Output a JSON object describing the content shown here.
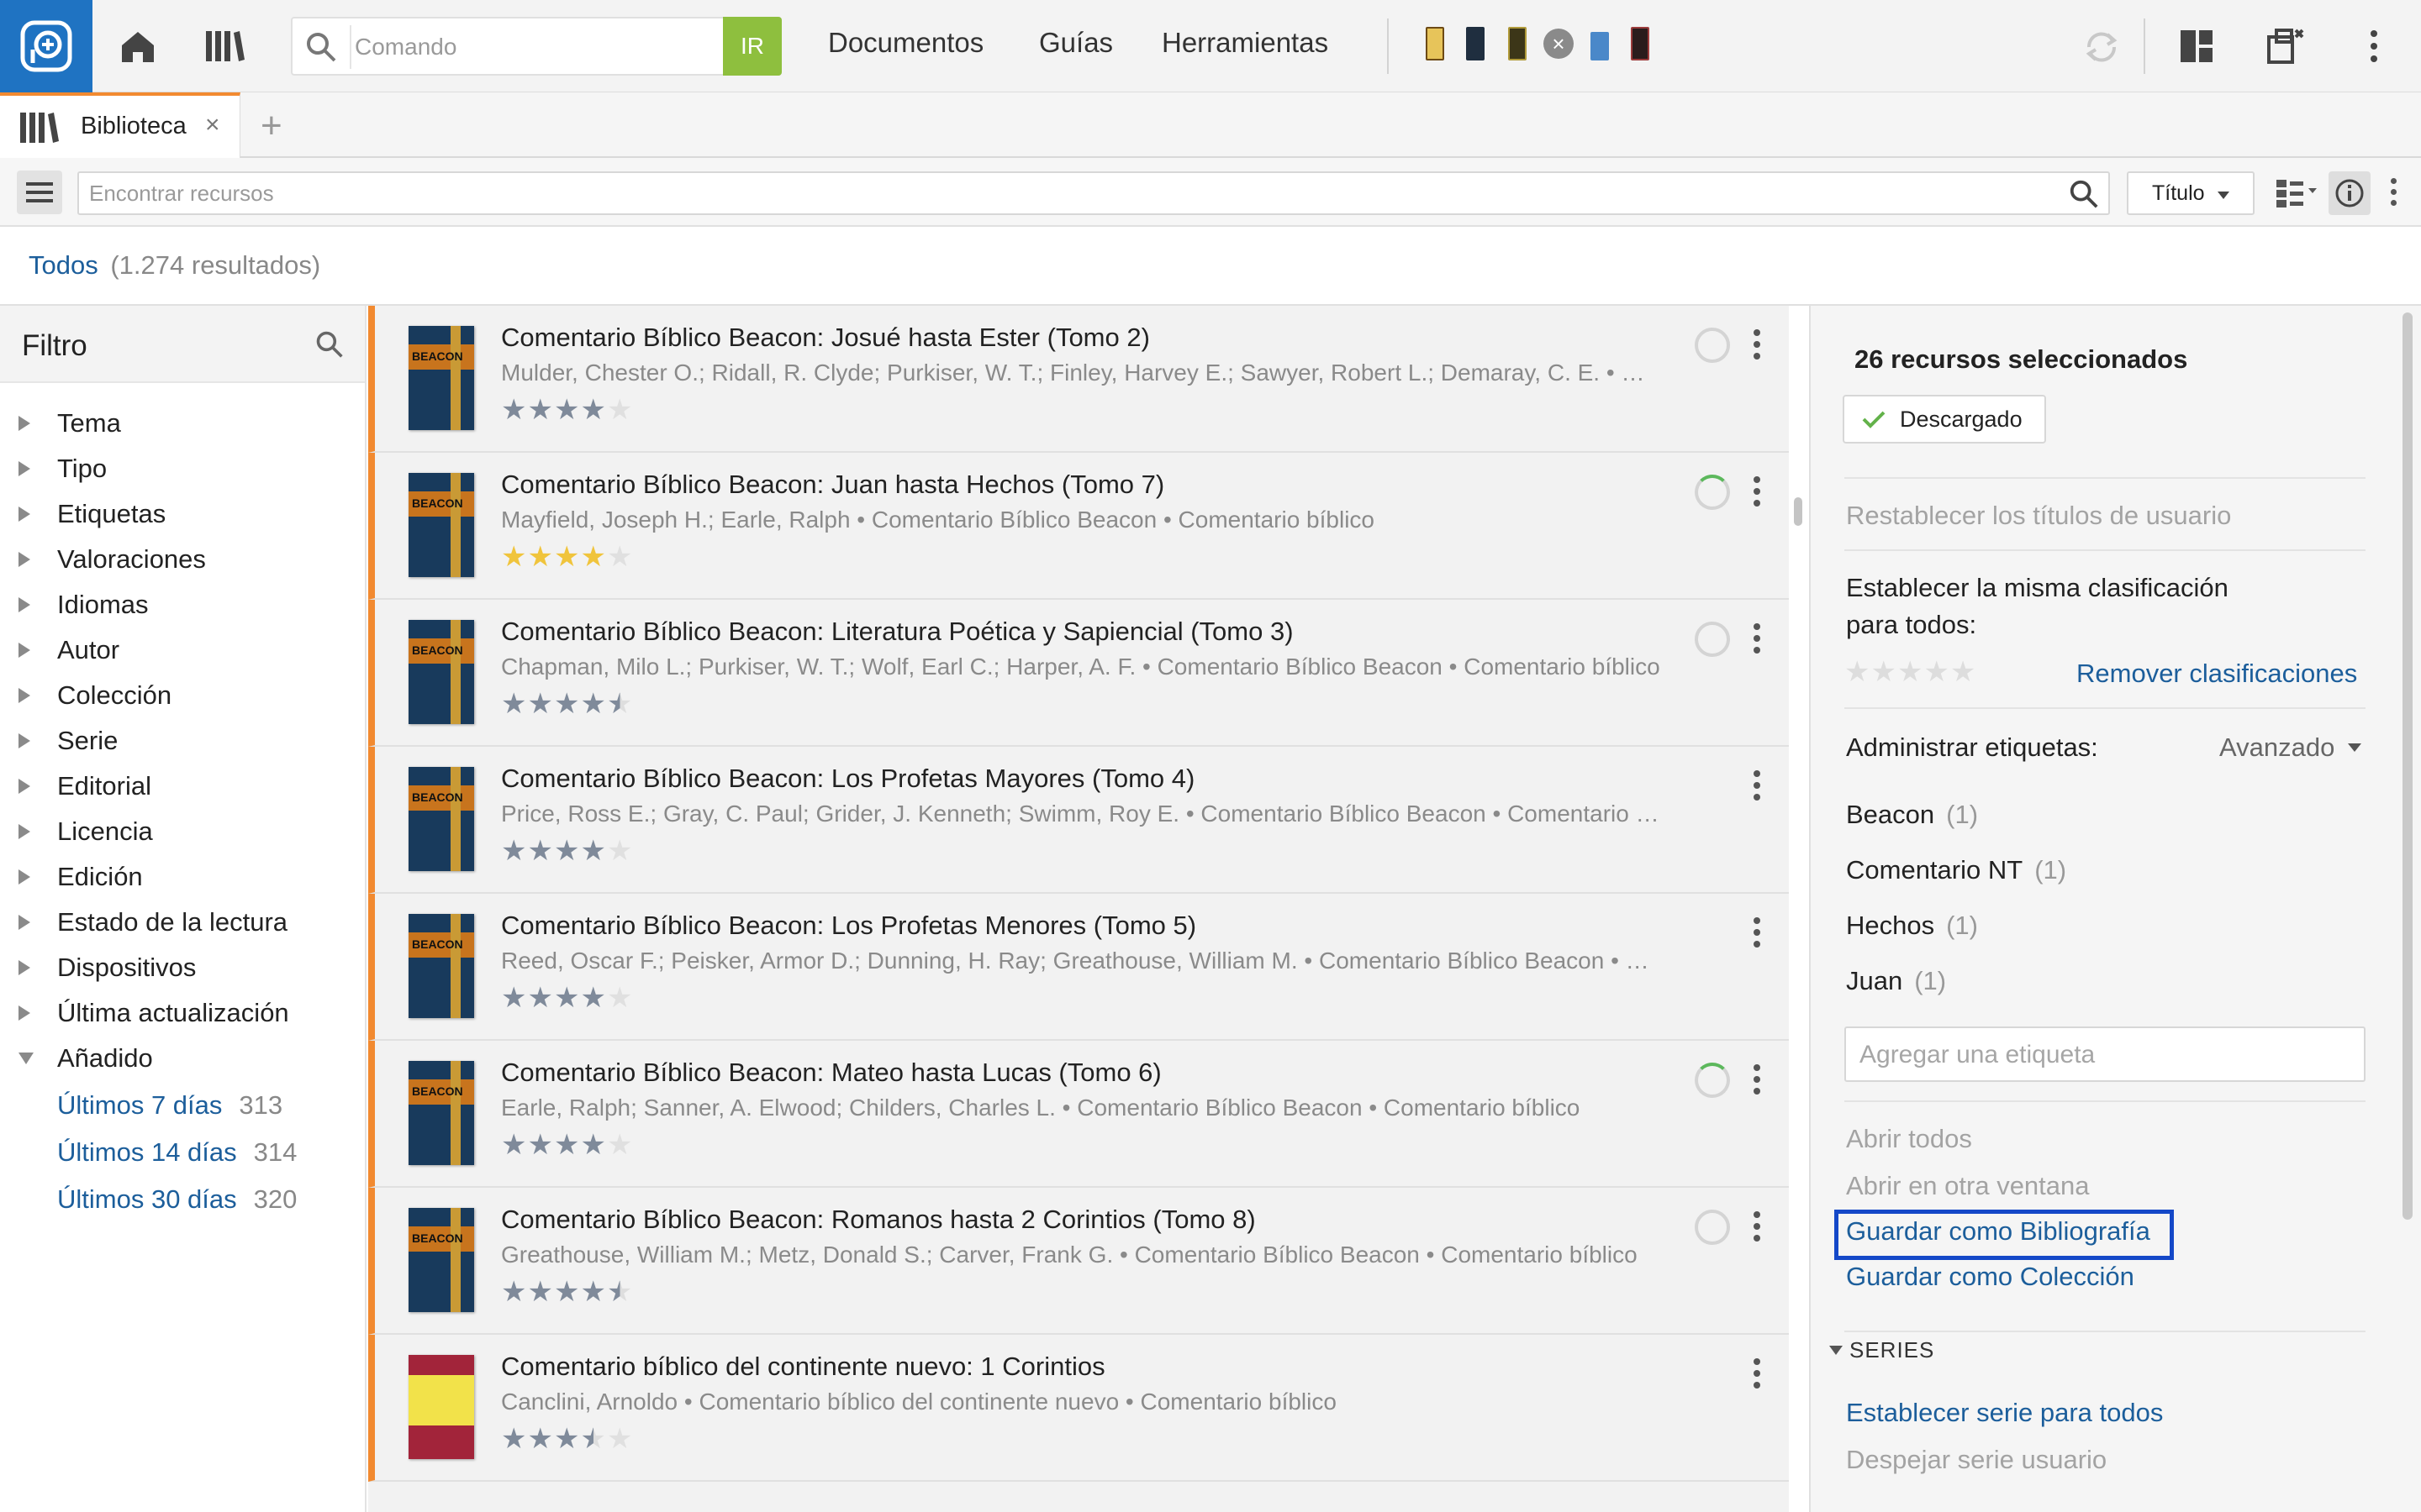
{
  "topbar": {
    "command_placeholder": "Comando",
    "go_label": "IR",
    "nav": [
      "Documentos",
      "Guías",
      "Herramientas"
    ]
  },
  "tab": {
    "label": "Biblioteca",
    "close": "×",
    "add": "+"
  },
  "search": {
    "placeholder": "Encontrar recursos",
    "sort_label": "Título"
  },
  "results": {
    "scope": "Todos",
    "count": "(1.274 resultados)"
  },
  "filter": {
    "title": "Filtro",
    "items": [
      "Tema",
      "Tipo",
      "Etiquetas",
      "Valoraciones",
      "Idiomas",
      "Autor",
      "Colección",
      "Serie",
      "Editorial",
      "Licencia",
      "Edición",
      "Estado de la lectura",
      "Dispositivos",
      "Última actualización"
    ],
    "expanded": {
      "label": "Añadido",
      "subitems": [
        {
          "label": "Últimos 7 días",
          "count": "313"
        },
        {
          "label": "Últimos 14 días",
          "count": "314"
        },
        {
          "label": "Últimos 30 días",
          "count": "320"
        }
      ]
    }
  },
  "resources": [
    {
      "title": "Comentario Bíblico Beacon: Josué hasta Ester (Tomo 2)",
      "meta": "Mulder, Chester O.; Ridall, R. Clyde; Purkiser, W. T.; Finley, Harvey E.; Sawyer, Robert L.; Demaray, C. E. • Comentario Bíblico Beacon • Comentario bíblico",
      "rating": 4,
      "star_color": "#7f8a9a",
      "cover": "BEACON",
      "cover_style": "blue",
      "status": "circle"
    },
    {
      "title": "Comentario Bíblico Beacon: Juan hasta Hechos (Tomo 7)",
      "meta": "Mayfield, Joseph H.; Earle, Ralph • Comentario Bíblico Beacon • Comentario bíblico",
      "rating": 4,
      "star_color": "#f0c43c",
      "cover": "BEACON",
      "cover_style": "blue",
      "status": "circle-progress"
    },
    {
      "title": "Comentario Bíblico Beacon: Literatura Poética y Sapiencial (Tomo 3)",
      "meta": "Chapman, Milo L.; Purkiser, W. T.; Wolf, Earl C.; Harper, A. F. • Comentario Bíblico Beacon • Comentario bíblico",
      "rating": 4.5,
      "star_color": "#7f8a9a",
      "cover": "BEACON",
      "cover_style": "blue",
      "status": "circle"
    },
    {
      "title": "Comentario Bíblico Beacon: Los Profetas Mayores (Tomo 4)",
      "meta": "Price, Ross E.; Gray, C. Paul; Grider, J. Kenneth; Swimm, Roy E. • Comentario Bíblico Beacon • Comentario bíblico",
      "rating": 4,
      "star_color": "#7f8a9a",
      "cover": "BEACON",
      "cover_style": "blue",
      "status": "none"
    },
    {
      "title": "Comentario Bíblico Beacon: Los Profetas Menores (Tomo 5)",
      "meta": "Reed, Oscar F.; Peisker, Armor D.; Dunning, H. Ray; Greathouse, William M. • Comentario Bíblico Beacon • Comentario bíblico",
      "rating": 4,
      "star_color": "#7f8a9a",
      "cover": "BEACON",
      "cover_style": "blue",
      "status": "none"
    },
    {
      "title": "Comentario Bíblico Beacon: Mateo hasta Lucas (Tomo 6)",
      "meta": "Earle, Ralph; Sanner, A. Elwood; Childers, Charles L. • Comentario Bíblico Beacon • Comentario bíblico",
      "rating": 4,
      "star_color": "#7f8a9a",
      "cover": "BEACON",
      "cover_style": "blue",
      "status": "circle-progress"
    },
    {
      "title": "Comentario Bíblico Beacon: Romanos hasta 2 Corintios (Tomo 8)",
      "meta": "Greathouse, William M.; Metz, Donald S.; Carver, Frank G. • Comentario Bíblico Beacon • Comentario bíblico",
      "rating": 4.5,
      "star_color": "#7f8a9a",
      "cover": "BEACON",
      "cover_style": "blue",
      "status": "circle"
    },
    {
      "title": "Comentario bíblico del continente nuevo: 1 Corintios",
      "meta": "Canclini, Arnoldo • Comentario bíblico del continente nuevo • Comentario bíblico",
      "rating": 3.5,
      "star_color": "#7f8a9a",
      "cover": "",
      "cover_style": "red",
      "status": "none"
    }
  ],
  "panel": {
    "selected": "26 recursos seleccionados",
    "downloaded": "Descargado",
    "reset_titles": "Restablecer los títulos de usuario",
    "same_rating_1": "Establecer la misma clasificación",
    "same_rating_2": "para todos:",
    "remove_ratings": "Remover clasificaciones",
    "manage_tags": "Administrar etiquetas:",
    "advanced": "Avanzado",
    "tags": [
      {
        "label": "Beacon",
        "count": "(1)"
      },
      {
        "label": "Comentario NT",
        "count": "(1)"
      },
      {
        "label": "Hechos",
        "count": "(1)"
      },
      {
        "label": "Juan",
        "count": "(1)"
      }
    ],
    "add_tag_placeholder": "Agregar una etiqueta",
    "open_all": "Abrir todos",
    "open_other_window": "Abrir en otra ventana",
    "save_bibliography": "Guardar como Bibliografía",
    "save_collection": "Guardar como Colección",
    "series_header": "SERIES",
    "set_series": "Establecer serie para todos",
    "clear_series": "Despejar serie usuario"
  },
  "colors": {
    "brand": "#1f73c2",
    "go": "#8ebf3e",
    "accent": "#f28a30",
    "link": "#1c5e9b",
    "focus": "#1448c8"
  },
  "icons": {
    "logo": "logos-app-icon",
    "home": "home-icon",
    "library": "library-icon",
    "search": "search-icon",
    "sync": "sync-icon",
    "layout": "layout-icon",
    "popout": "popout-icon",
    "more": "kebab-icon",
    "menu": "hamburger-icon",
    "view": "view-mode-icon",
    "info": "info-icon",
    "check": "check-icon"
  }
}
